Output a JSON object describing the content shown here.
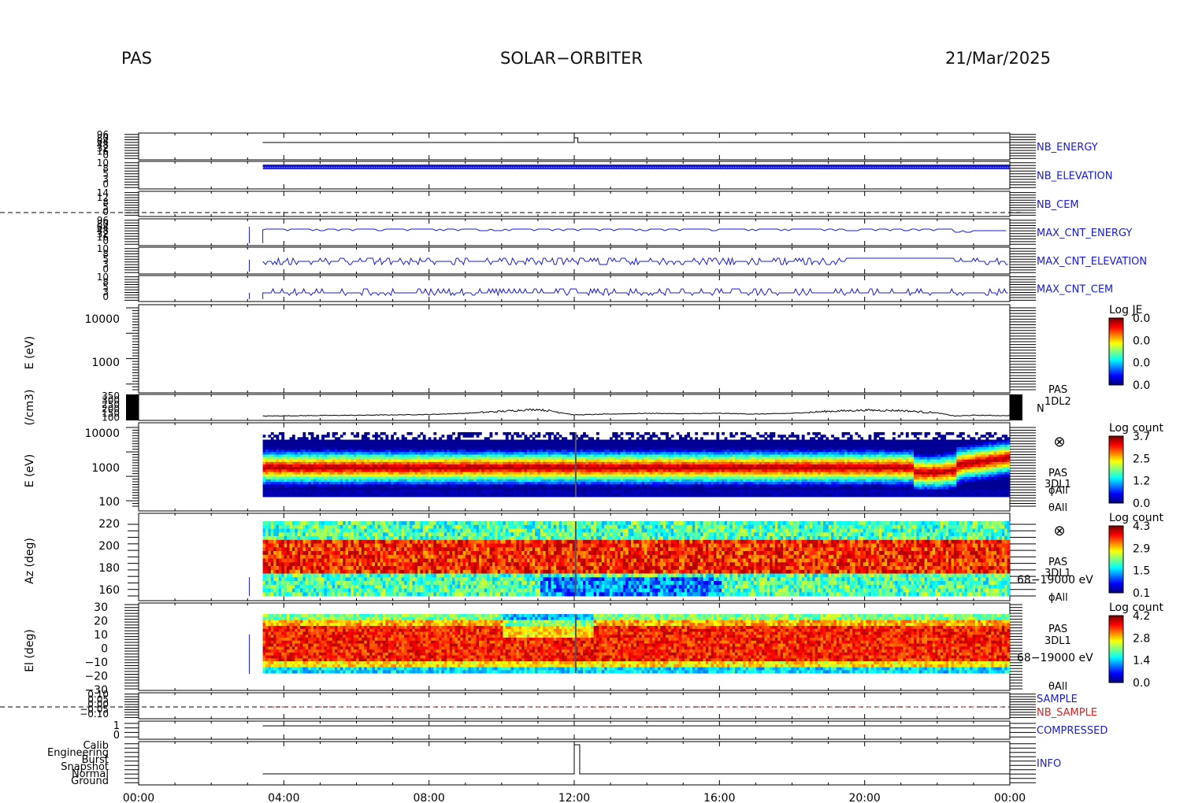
{
  "header": {
    "instrument": "PAS",
    "mission": "SOLAR−ORBITER",
    "date": "21/Mar/2025"
  },
  "time_axis": {
    "ticks": [
      "00:00",
      "04:00",
      "08:00",
      "12:00",
      "16:00",
      "20:00",
      "00:00"
    ]
  },
  "colors": {
    "trace": "#1a1ad6",
    "label": "#1a1ad6",
    "red_label": "#e02020",
    "black": "#000000"
  },
  "chart_data": [
    {
      "type": "line",
      "panel": "nb_energy",
      "label": "NB_ENERGY",
      "ytick_labels": [
        "96",
        "80",
        "64",
        "48",
        "32",
        "16",
        "0"
      ],
      "x": [
        "03:25",
        "12:00",
        "12:05",
        "24:00"
      ],
      "y_level": [
        0.6,
        0.6,
        0.2,
        0.6
      ]
    },
    {
      "type": "line",
      "panel": "nb_elevation",
      "label": "NB_ELEVATION",
      "ytick_labels": [
        "10",
        "8",
        "5",
        "3",
        "0"
      ],
      "note": "dense blue comb from 03:25 to 24:00"
    },
    {
      "type": "line",
      "panel": "nb_cem",
      "label": "NB_CEM",
      "ytick_labels": [
        "14",
        "12",
        "8",
        "5",
        "0"
      ]
    },
    {
      "type": "line",
      "panel": "max_cnt_energy",
      "label": "MAX_CNT_ENERGY",
      "ytick_labels": [
        "96",
        "80",
        "64",
        "48",
        "32",
        "16",
        "0"
      ]
    },
    {
      "type": "line",
      "panel": "max_cnt_elevation",
      "label": "MAX_CNT_ELEVATION",
      "ytick_labels": [
        "10",
        "8",
        "5",
        "3",
        "0"
      ]
    },
    {
      "type": "line",
      "panel": "max_cnt_cem",
      "label": "MAX_CNT_CEM",
      "ytick_labels": [
        "10",
        "8",
        "5",
        "3",
        "0"
      ]
    },
    {
      "type": "heatmap",
      "panel": "energy_flux_empty",
      "ylabel": "E (eV)",
      "ytick_labels": [
        "10000",
        "1000"
      ],
      "colorbar": {
        "title": "Log JE",
        "ticks": [
          "0.0",
          "0.0",
          "0.0",
          "0.0"
        ]
      }
    },
    {
      "type": "line",
      "panel": "density",
      "ylabel": "(/cm3)",
      "ytick_labels": [
        "350",
        "300",
        "250",
        "200",
        "150",
        "100"
      ],
      "right_label": [
        "PAS",
        "1DL2",
        "N"
      ],
      "x": [
        "03:25",
        "04:00",
        "05:00",
        "06:00",
        "07:00",
        "08:00",
        "09:00",
        "10:00",
        "10:30",
        "11:00",
        "11:30",
        "12:00",
        "13:00",
        "14:00",
        "15:00",
        "16:00",
        "17:00",
        "18:00",
        "19:00",
        "20:00",
        "21:00",
        "22:00",
        "22:30",
        "23:00",
        "24:00"
      ],
      "y": [
        115,
        118,
        122,
        125,
        130,
        135,
        150,
        175,
        190,
        200,
        170,
        130,
        140,
        150,
        145,
        150,
        140,
        150,
        175,
        190,
        185,
        155,
        115,
        125,
        120
      ]
    },
    {
      "type": "heatmap",
      "panel": "energy_spectrogram",
      "ylabel": "E (eV)",
      "ytick_labels": [
        "10000",
        "1000",
        "100"
      ],
      "right_label": [
        "PAS",
        "3DL1",
        "ϕAll",
        "θAll"
      ],
      "colorbar": {
        "title": "Log count",
        "ticks": [
          "3.7",
          "2.5",
          "1.2",
          "0.0"
        ]
      },
      "peak_energy_eV": 500
    },
    {
      "type": "heatmap",
      "panel": "azimuth_spectrogram",
      "ylabel": "Az (deg)",
      "ytick_labels": [
        "220",
        "200",
        "180",
        "160"
      ],
      "right_label": [
        "PAS",
        "3DL1",
        "68−19000 eV",
        "ϕAll"
      ],
      "colorbar": {
        "title": "Log count",
        "ticks": [
          "4.3",
          "2.9",
          "1.5",
          "0.1"
        ]
      }
    },
    {
      "type": "heatmap",
      "panel": "elevation_spectrogram",
      "ylabel": "El (deg)",
      "ytick_labels": [
        "30",
        "20",
        "10",
        "0",
        "−10",
        "−20",
        "−30"
      ],
      "right_label": [
        "PAS",
        "3DL1",
        "68−19000 eV",
        "θAll"
      ],
      "colorbar": {
        "title": "Log count",
        "ticks": [
          "4.2",
          "2.8",
          "1.4",
          "0.0"
        ]
      }
    },
    {
      "type": "line",
      "panel": "sample",
      "labels": [
        "SAMPLE",
        "NB_SAMPLE"
      ],
      "ytick_labels": [
        "0.10",
        "0.05",
        "0.00",
        "−0.05",
        "−0.10"
      ]
    },
    {
      "type": "line",
      "panel": "compressed",
      "label": "COMPRESSED",
      "ytick_labels": [
        "1",
        "0"
      ]
    },
    {
      "type": "line",
      "panel": "info",
      "label": "INFO",
      "ytick_labels": [
        "Calib",
        "Engineering",
        "Burst",
        "Snapshot",
        "Normal",
        "Ground"
      ],
      "x": [
        "03:25",
        "12:00",
        "12:10",
        "24:00"
      ],
      "state": [
        "Ground",
        "Calib",
        "Ground",
        "Ground"
      ]
    }
  ]
}
